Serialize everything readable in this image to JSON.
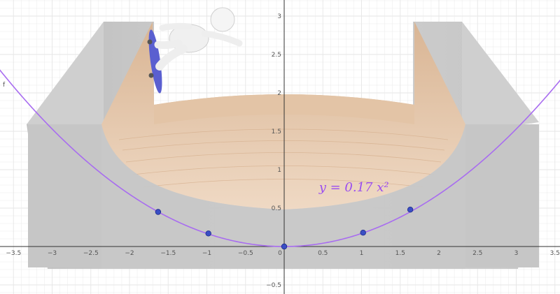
{
  "chart_data": {
    "type": "line",
    "title": "",
    "xlabel": "",
    "ylabel": "",
    "xlim": [
      -3.6,
      3.6
    ],
    "ylim": [
      -0.6,
      3.2
    ],
    "grid": true,
    "x_ticks": [
      -3.5,
      -3,
      -2.5,
      -2,
      -1.5,
      -1,
      -0.5,
      0,
      0.5,
      1,
      1.5,
      2,
      2.5,
      3,
      3.5
    ],
    "x_tick_labels": [
      "−3.5",
      "−3",
      "−2.5",
      "−2",
      "−1.5",
      "−1",
      "−0.5",
      "0",
      "0.5",
      "1",
      "1.5",
      "2",
      "2.5",
      "3",
      "3.5"
    ],
    "y_ticks": [
      -0.5,
      0.5,
      1,
      1.5,
      2,
      2.5,
      3
    ],
    "y_tick_labels": [
      "−0.5",
      "0.5",
      "1",
      "1.5",
      "2",
      "2.5",
      "3"
    ],
    "equation_label": "y = 0.17 x²",
    "curve_label": "f",
    "function": {
      "coefficient": 0.17,
      "exponent": 2
    },
    "points": [
      {
        "x": -1.63,
        "y": 0.45
      },
      {
        "x": -0.98,
        "y": 0.17
      },
      {
        "x": 0.0,
        "y": 0.0
      },
      {
        "x": 1.02,
        "y": 0.18
      },
      {
        "x": 1.63,
        "y": 0.48
      }
    ],
    "colors": {
      "curve": "#a86cf0",
      "points": "#3a4fc4",
      "ramp_wood": "#e8c9ad",
      "block": "#c9c9c9",
      "grid": "#e6e6e6",
      "axes": "#333333"
    }
  },
  "illustration": {
    "subject": "skateboarder-figure",
    "scene": "half-pipe-ramp"
  }
}
